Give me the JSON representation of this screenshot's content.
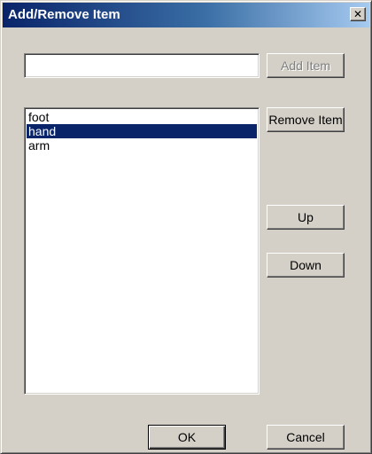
{
  "window": {
    "title": "Add/Remove Item",
    "close_glyph": "✕"
  },
  "input": {
    "value": "",
    "placeholder": ""
  },
  "buttons": {
    "add_item": "Add Item",
    "remove_item": "Remove Item",
    "up": "Up",
    "down": "Down",
    "ok": "OK",
    "cancel": "Cancel"
  },
  "list": {
    "items": [
      "foot",
      "hand",
      "arm"
    ],
    "selected": "hand"
  },
  "colors": {
    "title_bar": "#0a246a",
    "selection": "#0a246a",
    "dialog_face": "#d4d0c8"
  }
}
